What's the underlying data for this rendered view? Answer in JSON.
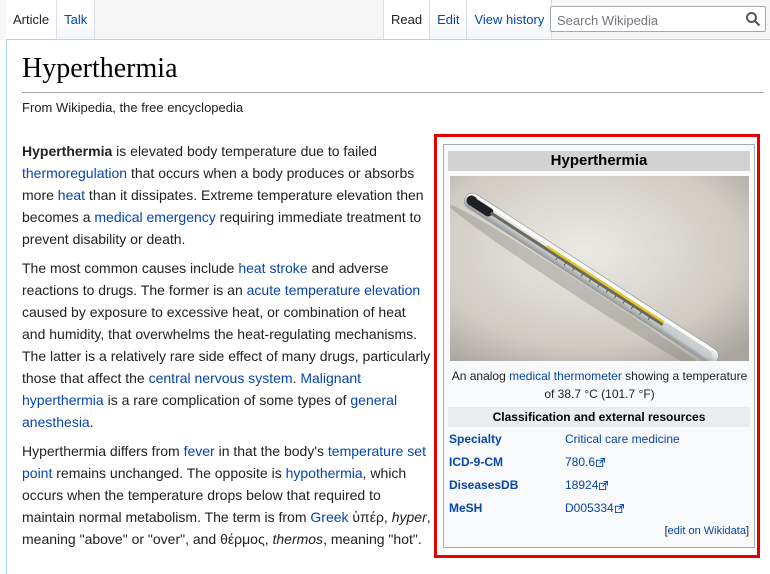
{
  "tabs": {
    "left": [
      {
        "label": "Article",
        "selected": true
      },
      {
        "label": "Talk",
        "selected": false
      }
    ],
    "right": [
      {
        "label": "Read",
        "selected": true
      },
      {
        "label": "Edit",
        "selected": false
      },
      {
        "label": "View history",
        "selected": false
      }
    ]
  },
  "search": {
    "placeholder": "Search Wikipedia",
    "icon": "search-icon"
  },
  "article": {
    "title": "Hyperthermia",
    "tagline": "From Wikipedia, the free encyclopedia",
    "p1": {
      "s1": "Hyperthermia",
      "s2": " is elevated body temperature due to failed ",
      "l1": "thermoregulation",
      "s3": " that occurs when a body produces or absorbs more ",
      "l2": "heat",
      "s4": " than it dissipates. Extreme temperature elevation then becomes a ",
      "l3": "medical emergency",
      "s5": " requiring immediate treatment to prevent disability or death."
    },
    "p2": {
      "s1": "The most common causes include ",
      "l1": "heat stroke",
      "s2": " and adverse reactions to drugs. The former is an ",
      "l2": "acute temperature elevation",
      "s3": " caused by exposure to excessive heat, or combination of heat and humidity, that overwhelms the heat-regulating mechanisms. The latter is a relatively rare side effect of many drugs, particularly those that affect the ",
      "l3": "central nervous system",
      "s4": ". ",
      "l4": "Malignant hyperthermia",
      "s5": " is a rare complication of some types of ",
      "l5": "general anesthesia",
      "s6": "."
    },
    "p3": {
      "s1": "Hyperthermia differs from ",
      "l1": "fever",
      "s2": " in that the body's ",
      "l2": "temperature set point",
      "s3": " remains unchanged. The opposite is ",
      "l3": "hypothermia",
      "s4": ", which occurs when the temperature drops below that required to maintain normal metabolism. The term is from ",
      "l4": "Greek",
      "s5": " ὑπέρ, ",
      "i1": "hyper",
      "s6": ", meaning \"above\" or \"over\", and θέρμος, ",
      "i2": "thermos",
      "s7": ", meaning \"hot\"."
    }
  },
  "infobox": {
    "title": "Hyperthermia",
    "caption_pre": "An analog ",
    "caption_link": "medical thermometer",
    "caption_post": " showing a temperature of 38.7 °C (101.7 °F)",
    "subheader": "Classification and external resources",
    "rows": [
      {
        "key": "Specialty",
        "value": "Critical care medicine",
        "external": false
      },
      {
        "key": "ICD-9-CM",
        "value": "780.6",
        "external": true
      },
      {
        "key": "DiseasesDB",
        "value": "18924",
        "external": true
      },
      {
        "key": "MeSH",
        "value": "D005334",
        "external": true
      }
    ],
    "edit_prefix": "[",
    "edit_link": "edit on Wikidata",
    "edit_suffix": "]"
  },
  "colors": {
    "link": "#0645ad",
    "highlight": "#e50000",
    "infobox_bg": "#f8f9fa"
  }
}
